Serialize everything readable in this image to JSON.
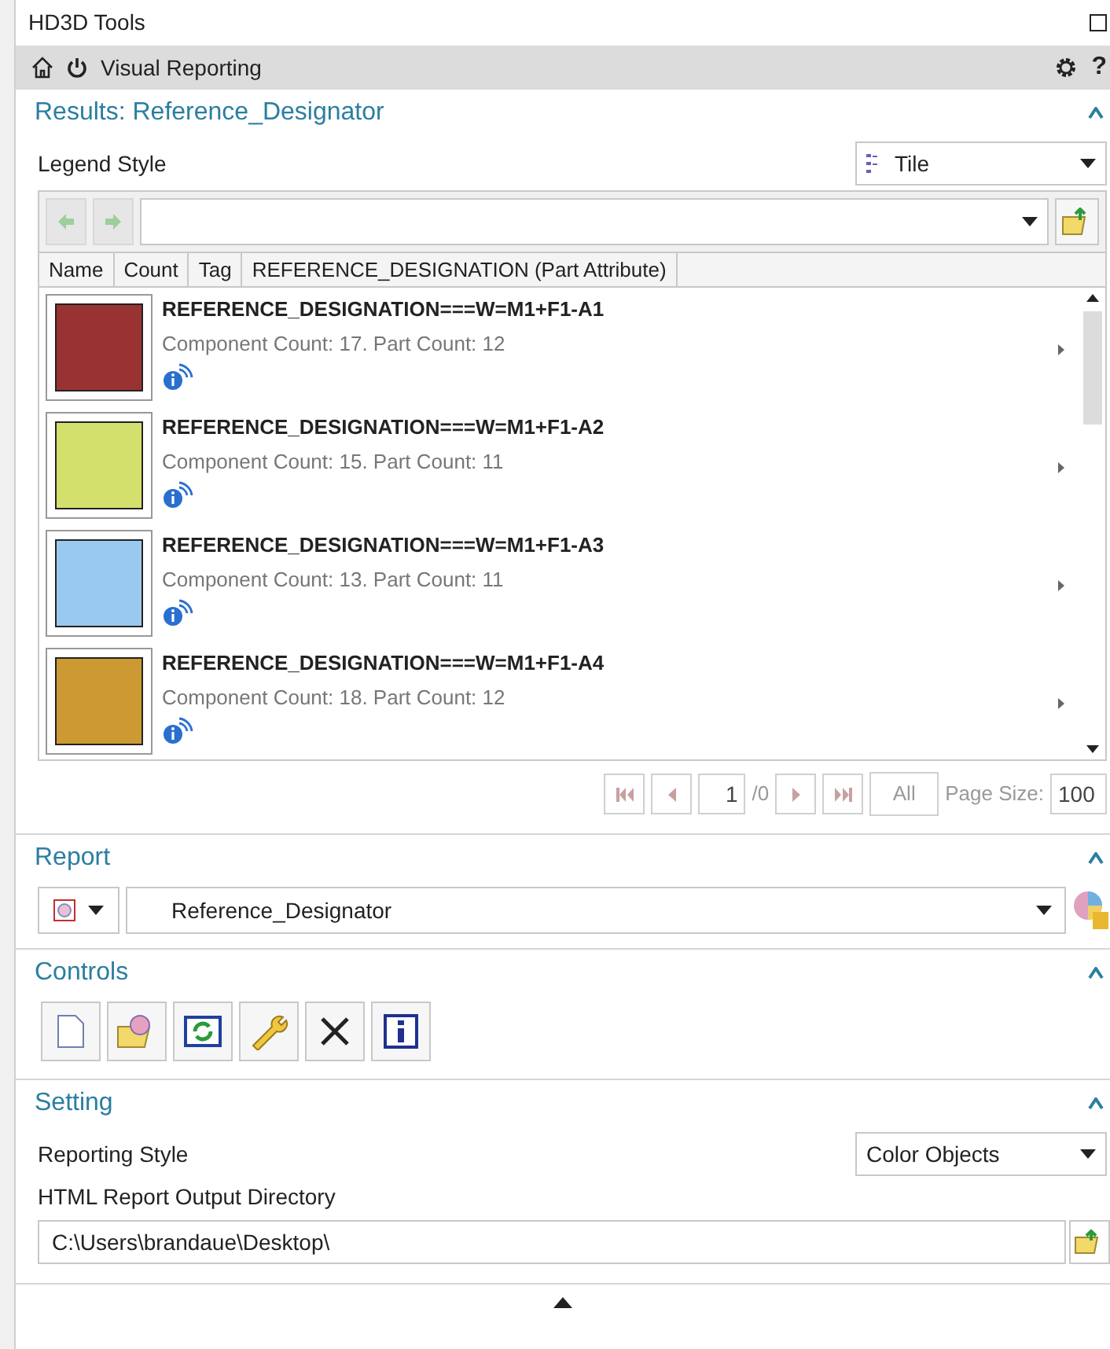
{
  "window": {
    "title": "HD3D Tools"
  },
  "toolbar": {
    "title": "Visual Reporting",
    "help": "?"
  },
  "results": {
    "title": "Results: Reference_Designator",
    "legend_style": {
      "label": "Legend Style",
      "value": "Tile"
    },
    "columns": [
      "Name",
      "Count",
      "Tag",
      "REFERENCE_DESIGNATION (Part Attribute)"
    ],
    "items": [
      {
        "title": "REFERENCE_DESIGNATION===W=M1+F1-A1",
        "detail": "Component Count: 17. Part Count: 12",
        "color": "#993333"
      },
      {
        "title": "REFERENCE_DESIGNATION===W=M1+F1-A2",
        "detail": "Component Count: 15. Part Count: 11",
        "color": "#d4e06c"
      },
      {
        "title": "REFERENCE_DESIGNATION===W=M1+F1-A3",
        "detail": "Component Count: 13. Part Count: 11",
        "color": "#99c9ee"
      },
      {
        "title": "REFERENCE_DESIGNATION===W=M1+F1-A4",
        "detail": "Component Count: 18. Part Count: 12",
        "color": "#cc9933"
      }
    ],
    "pager": {
      "page": "1",
      "total": "/0",
      "all": "All",
      "page_size_label": "Page Size:",
      "page_size": "100"
    }
  },
  "report": {
    "title": "Report",
    "value": "Reference_Designator"
  },
  "controls": {
    "title": "Controls"
  },
  "setting": {
    "title": "Setting",
    "reporting_style": {
      "label": "Reporting Style",
      "value": "Color Objects"
    },
    "output_dir": {
      "label": "HTML Report Output Directory",
      "value": "C:\\Users\\brandaue\\Desktop\\"
    }
  }
}
